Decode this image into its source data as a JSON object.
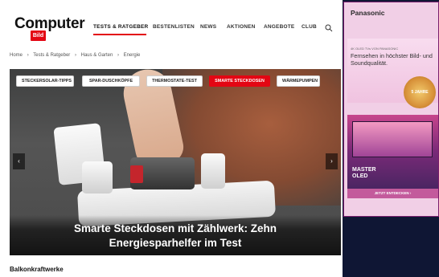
{
  "header": {
    "logo_text": "Computer",
    "logo_sub": "Bild",
    "nav": [
      {
        "label": "TESTS & RATGEBER"
      },
      {
        "label": "BESTENLISTEN"
      },
      {
        "label": "NEWS"
      },
      {
        "label": "AKTIONEN"
      },
      {
        "label": "ANGEBOTE"
      },
      {
        "label": "CLUB"
      }
    ]
  },
  "breadcrumb": [
    "Home",
    "›",
    "Tests & Ratgeber",
    "›",
    "Haus & Garten",
    "›",
    "Energie"
  ],
  "chips": [
    {
      "label": "STECKERSOLAR-TIPPS"
    },
    {
      "label": "SPAR-DUSCHKÖPFE"
    },
    {
      "label": "THERMOSTATE-TEST"
    },
    {
      "label": "SMARTE STECKDOSEN"
    },
    {
      "label": "WÄRMEPUMPEN"
    }
  ],
  "hero": {
    "title_line1": "Smarte Steckdosen mit Zählwerk: Zehn",
    "title_line2": "Energiesparhelfer im Test",
    "prev": "‹",
    "next": "›"
  },
  "section": {
    "heading": "Balkonkraftwerke"
  },
  "ad": {
    "brand": "Panasonic",
    "small": "4K OLED TVs VON PANASONIC",
    "headline": "Fernsehen in höchster Bild- und Soundqualität.",
    "badge": "5 JAHRE GARANTIE",
    "oled_line1": "MASTER",
    "oled_line2": "OLED",
    "cta": "JETZT ENTDECKEN ›"
  }
}
